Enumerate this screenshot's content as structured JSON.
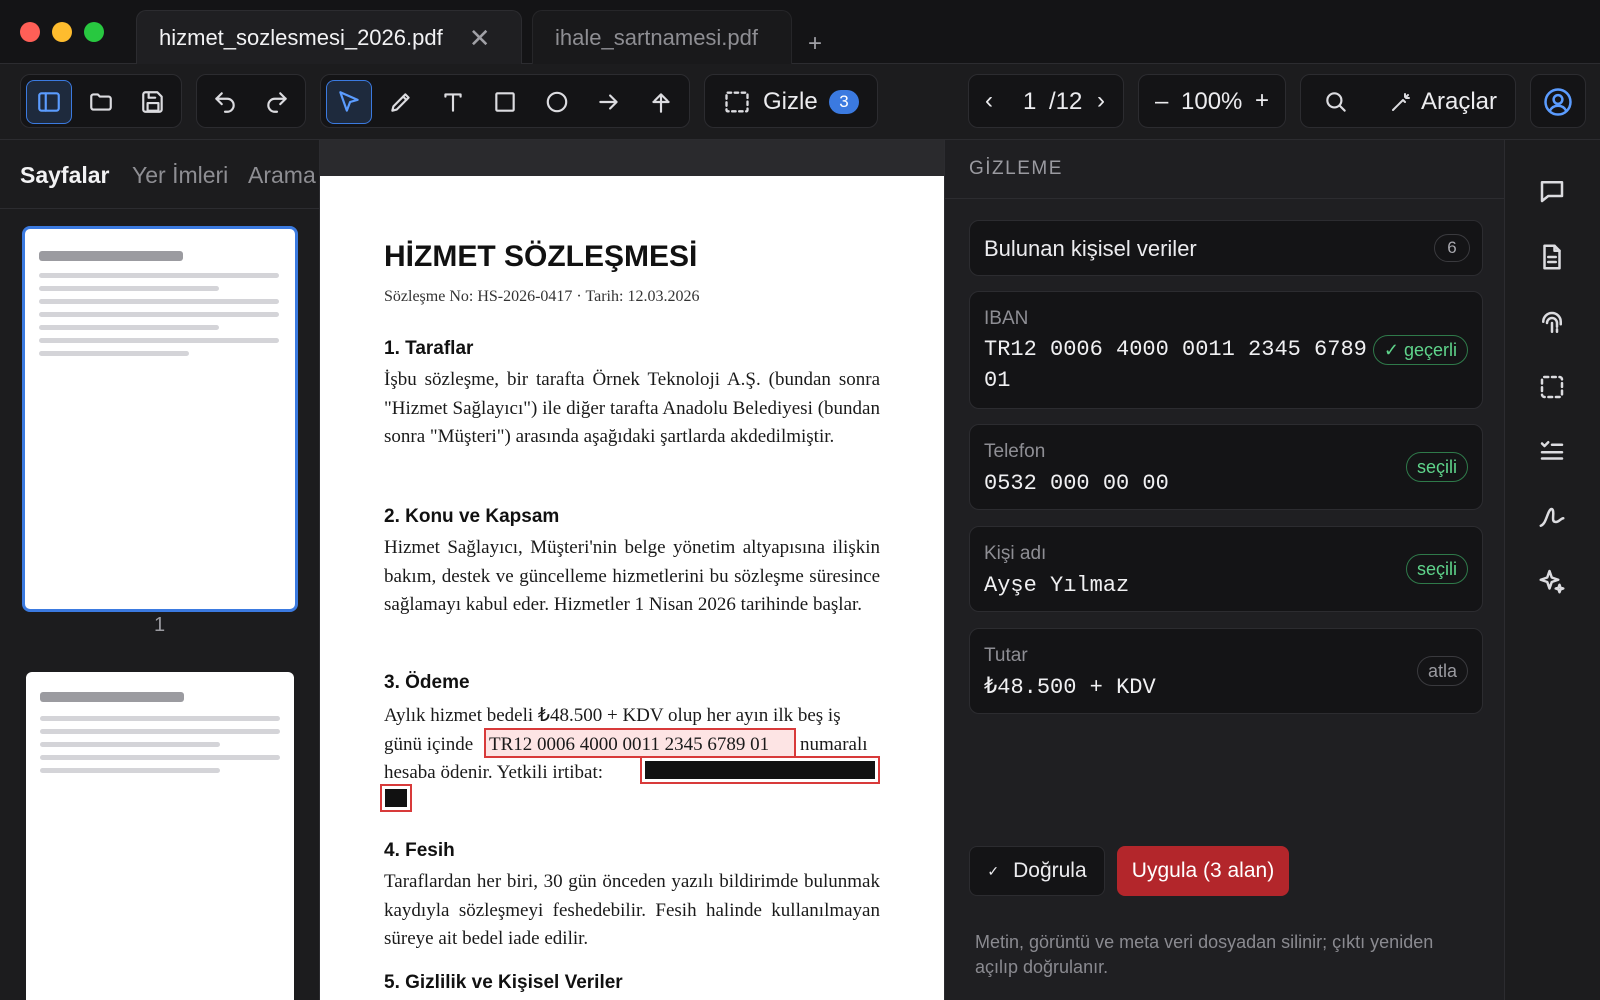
{
  "tabs": [
    {
      "label": "hizmet_sozlesmesi_2026.pdf",
      "active": true
    },
    {
      "label": "ihale_sartnamesi.pdf",
      "active": false
    }
  ],
  "toolbar": {
    "redact_label": "Gizle",
    "redact_count": "3",
    "page_current": "1",
    "page_total": "/12",
    "zoom": "100%",
    "tools_label": "Araçlar"
  },
  "sidebar": {
    "tabs": [
      "Sayfalar",
      "Yer İmleri",
      "Arama"
    ],
    "active_tab": "Sayfalar",
    "page_label": "1"
  },
  "document": {
    "title": "HİZMET SÖZLEŞMESİ",
    "meta": "Sözleşme No: HS-2026-0417 · Tarih: 12.03.2026",
    "sec1_title": "1. Taraflar",
    "sec1_text": "İşbu sözleşme, bir tarafta Örnek Teknoloji A.Ş. (bundan sonra \"Hizmet Sağlayıcı\") ile diğer tarafta Anadolu Belediyesi (bundan sonra \"Müşteri\") arasında aşağıdaki şartlarda akdedilmiştir.",
    "sec2_title": "2. Konu ve Kapsam",
    "sec2_text": "Hizmet Sağlayıcı, Müşteri'nin belge yönetim altyapısına ilişkin bakım, destek ve güncelleme hizmetlerini bu sözleşme süresince sağlamayı kabul eder. Hizmetler 1 Nisan 2026 tarihinde başlar.",
    "sec3_title": "3. Ödeme",
    "sec3_line1": "Aylık hizmet bedeli ₺48.500 + KDV olup her ayın ilk beş iş",
    "sec3_line2_pre": "günü içinde",
    "sec3_iban": "TR12 0006 4000 0011 2345 6789 01",
    "sec3_line2_post": "numaralı",
    "sec3_line3": "hesaba ödenir. Yetkili irtibat:",
    "sec4_title": "4. Fesih",
    "sec4_text": "Taraflardan her biri, 30 gün önceden yazılı bildirimde bulunmak kaydıyla sözleşmeyi feshedebilir. Fesih halinde kullanılmayan süreye ait bedel iade edilir.",
    "sec5_title": "5. Gizlilik ve Kişisel Veriler"
  },
  "panel": {
    "header": "GİZLEME",
    "summary_label": "Bulunan kişisel veriler",
    "summary_count": "6",
    "items": [
      {
        "label": "IBAN",
        "value_line1": "TR12 0006 4000 0011 2345 6789",
        "value_line2": "01",
        "status": "✓ geçerli"
      },
      {
        "label": "Telefon",
        "value": "0532 000 00 00",
        "status": "seçili"
      },
      {
        "label": "Kişi adı",
        "value": "Ayşe Yılmaz",
        "status": "seçili"
      },
      {
        "label": "Tutar",
        "value": "₺48.500 + KDV",
        "status": "atla"
      }
    ],
    "verify_label": "Doğrula",
    "apply_label": "Uygula (3 alan)",
    "note": "Metin, görüntü ve meta veri dosyadan silinir; çıktı yeniden açılıp doğrulanır."
  },
  "colors": {
    "accent": "#3b7ae0",
    "danger": "#b3262b",
    "success": "#5fd48b",
    "redact_border": "#d83a3a"
  },
  "icons": {
    "toolbar": [
      "sidebar-toggle-icon",
      "folder-icon",
      "save-icon",
      "undo-icon",
      "redo-icon",
      "select-arrow-icon",
      "pen-icon",
      "text-icon",
      "rectangle-icon",
      "circle-icon",
      "arrow-icon",
      "upload-icon",
      "redact-area-icon",
      "search-icon",
      "wand-icon",
      "user-icon"
    ],
    "rail": [
      "comment-icon",
      "document-icon",
      "fingerprint-icon",
      "redact-area-icon",
      "checklist-icon",
      "signature-icon",
      "sparkle-icon"
    ]
  }
}
